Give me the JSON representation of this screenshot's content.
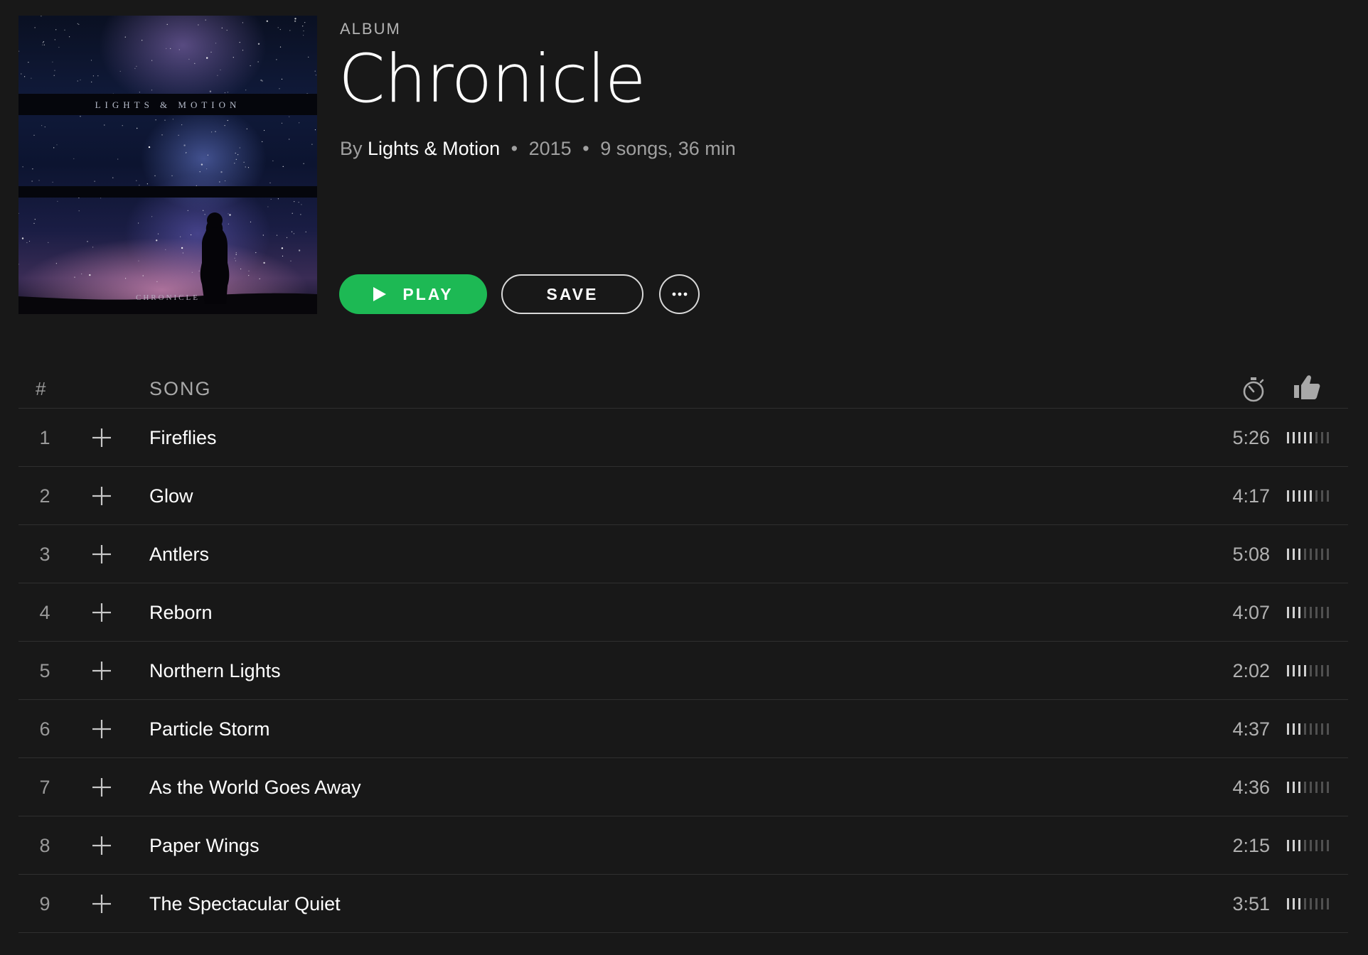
{
  "album": {
    "type_label": "ALBUM",
    "title": "Chronicle",
    "by_prefix": "By",
    "artist": "Lights & Motion",
    "year": "2015",
    "summary": "9 songs, 36 min",
    "separator": "•",
    "cover": {
      "top_text": "LIGHTS & MOTION",
      "bottom_text": "CHRONICLE"
    }
  },
  "actions": {
    "play_label": "PLAY",
    "save_label": "SAVE",
    "more_icon": "ellipsis-icon"
  },
  "colors": {
    "background": "#181818",
    "accent": "#1db954",
    "muted_text": "#b3b3b3"
  },
  "tracklist": {
    "header": {
      "number_label": "#",
      "song_label": "SONG",
      "duration_icon": "stopwatch-icon",
      "popularity_icon": "thumbs-up-icon"
    },
    "tracks": [
      {
        "number": "1",
        "title": "Fireflies",
        "duration": "5:26",
        "popularity": 5
      },
      {
        "number": "2",
        "title": "Glow",
        "duration": "4:17",
        "popularity": 5
      },
      {
        "number": "3",
        "title": "Antlers",
        "duration": "5:08",
        "popularity": 3
      },
      {
        "number": "4",
        "title": "Reborn",
        "duration": "4:07",
        "popularity": 3
      },
      {
        "number": "5",
        "title": "Northern Lights",
        "duration": "2:02",
        "popularity": 4
      },
      {
        "number": "6",
        "title": "Particle Storm",
        "duration": "4:37",
        "popularity": 3
      },
      {
        "number": "7",
        "title": "As the World Goes Away",
        "duration": "4:36",
        "popularity": 3
      },
      {
        "number": "8",
        "title": "Paper Wings",
        "duration": "2:15",
        "popularity": 3
      },
      {
        "number": "9",
        "title": "The Spectacular Quiet",
        "duration": "3:51",
        "popularity": 3
      }
    ],
    "popularity_scale": 8
  }
}
